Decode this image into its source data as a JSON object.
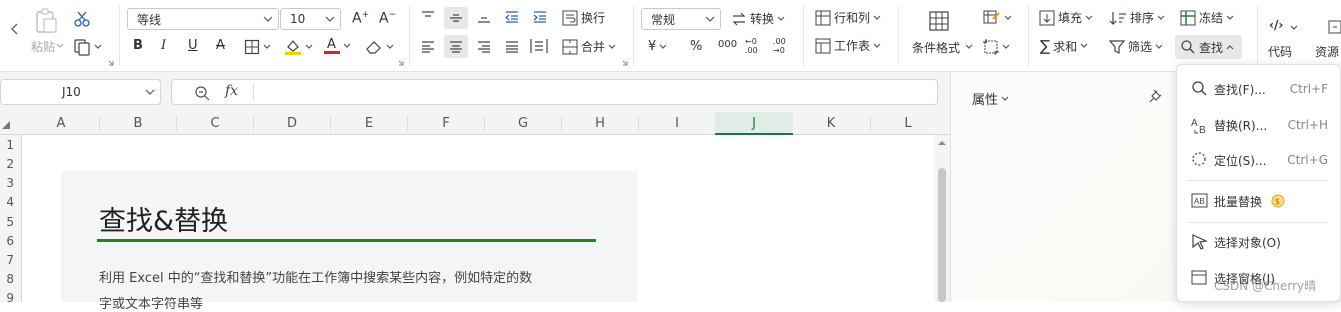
{
  "ribbon": {
    "paste_label": "粘贴",
    "font_name": "等线",
    "font_size": "10",
    "wrap_label": "换行",
    "merge_label": "合并",
    "number_format": "常规",
    "convert_label": "转换",
    "rowcol_label": "行和列",
    "worksheet_label": "工作表",
    "cond_format_label": "条件格式",
    "fill_label": "填充",
    "sort_label": "排序",
    "freeze_label": "冻结",
    "sum_label": "求和",
    "filter_label": "筛选",
    "find_label": "查找",
    "code_label": "代码",
    "resource_label": "资源",
    "currency_symbol": "¥",
    "percent_symbol": "%",
    "thousands_symbol": "000",
    "inc_decimal": "←0 .00",
    "dec_decimal": ".00 →0"
  },
  "formula_bar": {
    "name_box": "J10",
    "fx_label": "fx",
    "formula": ""
  },
  "columns": [
    "A",
    "B",
    "C",
    "D",
    "E",
    "F",
    "G",
    "H",
    "I",
    "J",
    "K",
    "L"
  ],
  "selected_column": "J",
  "rows": [
    "1",
    "2",
    "3",
    "4",
    "5",
    "6",
    "7",
    "8",
    "9"
  ],
  "sheet_content": {
    "title": "查找&替换",
    "body_line1": "利用 Excel 中的“查找和替换”功能在工作簿中搜索某些内容，例如特定的数",
    "body_line2": "字或文本字符串等"
  },
  "side_pane": {
    "title": "属性"
  },
  "find_menu": {
    "items": [
      {
        "label": "查找(F)...",
        "shortcut": "Ctrl+F",
        "icon": "search-icon"
      },
      {
        "label": "替换(R)...",
        "shortcut": "Ctrl+H",
        "icon": "replace-icon"
      },
      {
        "label": "定位(S)...",
        "shortcut": "Ctrl+G",
        "icon": "locate-icon"
      },
      {
        "label": "批量替换",
        "shortcut": "",
        "icon": "batch-replace-icon"
      },
      {
        "label": "选择对象(O)",
        "shortcut": "",
        "icon": "select-object-icon"
      },
      {
        "label": "选择窗格(J)",
        "shortcut": "",
        "icon": "selection-pane-icon"
      }
    ]
  },
  "watermark": "CSDN @Cherry晴",
  "colors": {
    "accent_green": "#2e7d32",
    "selected_col": "#217346",
    "font_color_red": "#e02020",
    "highlight_yellow": "#f5d000"
  }
}
